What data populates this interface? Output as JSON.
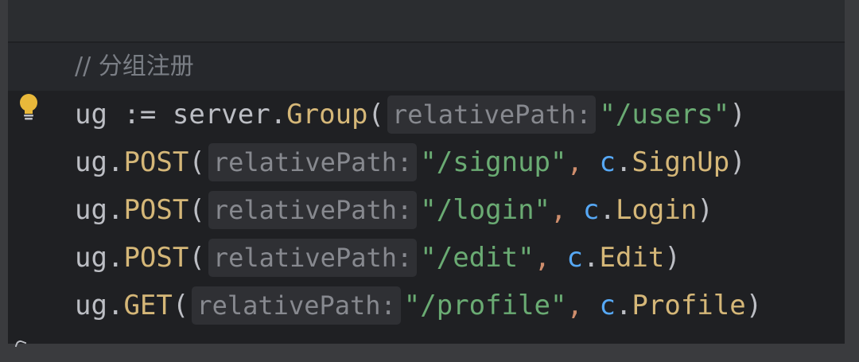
{
  "editor": {
    "comment": "// 分组注册",
    "lines": [
      {
        "receiver": "ug",
        "op": " := ",
        "obj": "server",
        "dot": ".",
        "method": "Group",
        "open": "(",
        "hint": "relativePath:",
        "arg": "\"/users\"",
        "close": ")"
      },
      {
        "receiver": "ug",
        "dot": ".",
        "method": "POST",
        "open": "(",
        "hint": "relativePath:",
        "arg": "\"/signup\"",
        "comma": ", ",
        "ctx": "c",
        "dot2": ".",
        "handler": "SignUp",
        "close": ")"
      },
      {
        "receiver": "ug",
        "dot": ".",
        "method": "POST",
        "open": "(",
        "hint": "relativePath:",
        "arg": "\"/login\"",
        "comma": ", ",
        "ctx": "c",
        "dot2": ".",
        "handler": "Login",
        "close": ")"
      },
      {
        "receiver": "ug",
        "dot": ".",
        "method": "POST",
        "open": "(",
        "hint": "relativePath:",
        "arg": "\"/edit\"",
        "comma": ", ",
        "ctx": "c",
        "dot2": ".",
        "handler": "Edit",
        "close": ")"
      },
      {
        "receiver": "ug",
        "dot": ".",
        "method": "GET",
        "open": "(",
        "hint": "relativePath:",
        "arg": "\"/profile\"",
        "comma": ", ",
        "ctx": "c",
        "dot2": ".",
        "handler": "Profile",
        "close": ")"
      }
    ]
  },
  "icons": {
    "intention": "lightbulb-icon"
  },
  "colors": {
    "background": "#1f2023",
    "text": "#bcbec4",
    "comment": "#7a7e85",
    "function": "#d5b778",
    "string": "#6aab73",
    "keyword": "#cf8e6d",
    "receiver": "#56a8f5",
    "hint_bg": "#2f3034",
    "bulb": "#e8b83a"
  }
}
